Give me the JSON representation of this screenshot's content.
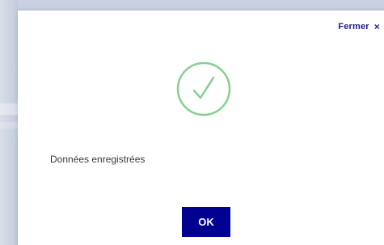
{
  "dialog": {
    "close_label": "Fermer",
    "close_symbol": "×",
    "status_icon": "check-circle-icon",
    "message": "Données enregistrées",
    "ok_label": "OK"
  },
  "colors": {
    "accent": "#000091",
    "success": "#86d08d",
    "text": "#3a3a3a"
  }
}
